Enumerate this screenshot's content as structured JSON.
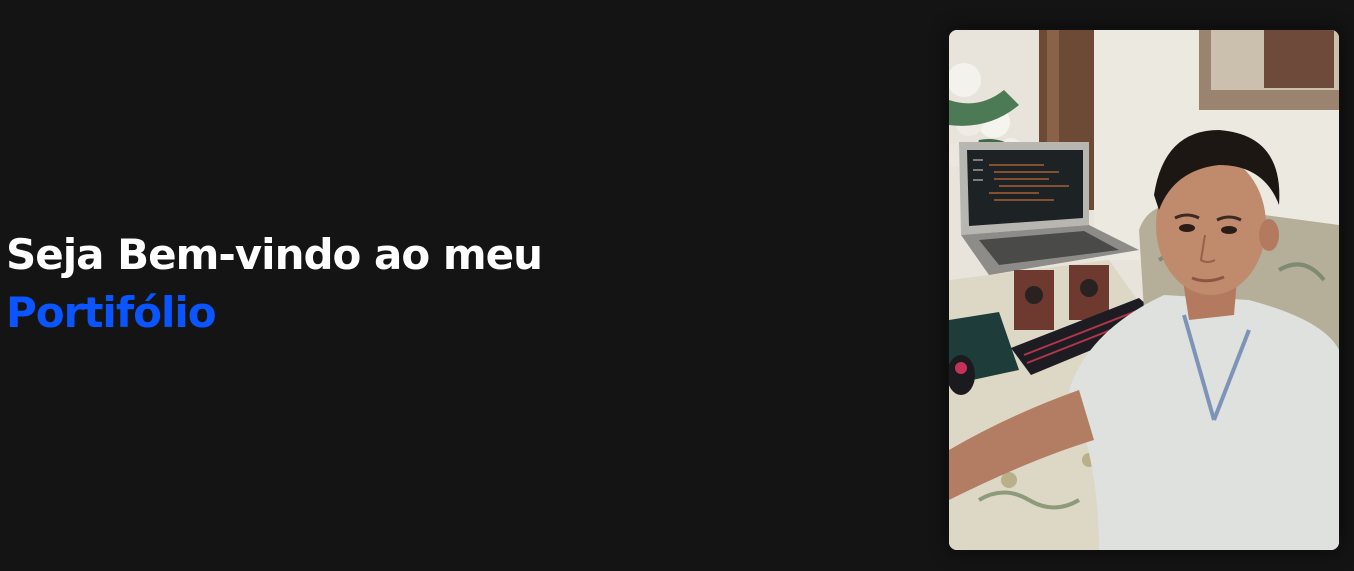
{
  "hero": {
    "title": "Seja Bem-vindo ao meu",
    "accent": "Portifólio",
    "accent_color": "#0a55ff",
    "background_color": "#141414"
  },
  "profile_photo": {
    "subject": "portrait of boy seated at desk with laptop, keyboard and mouse"
  }
}
